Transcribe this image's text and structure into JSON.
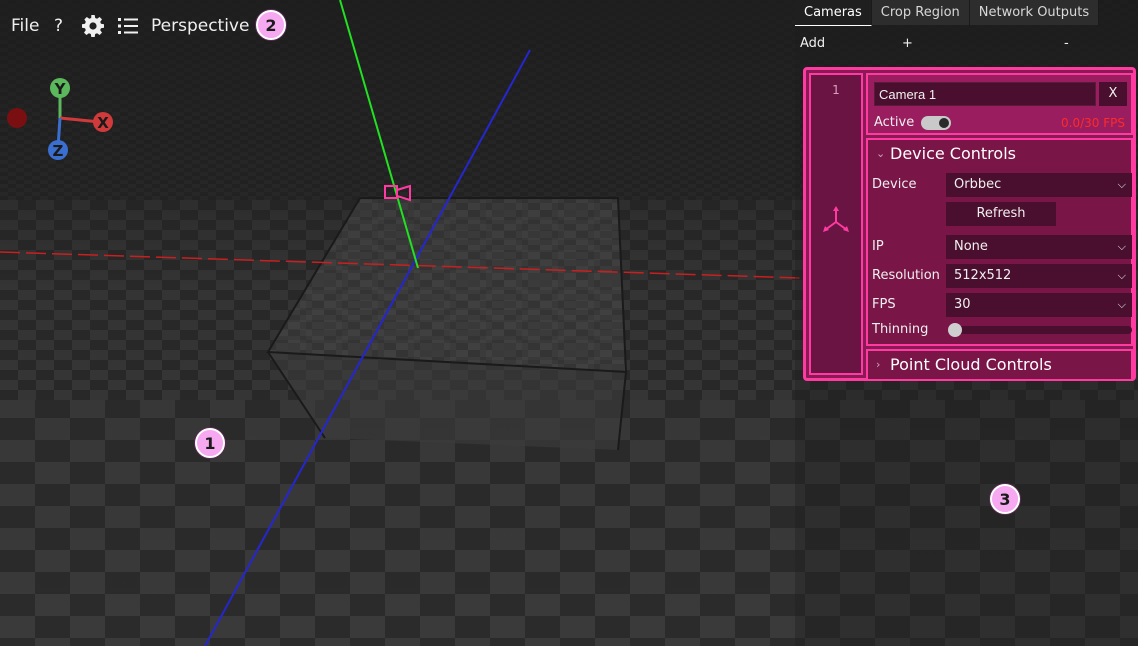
{
  "toolbar": {
    "file_label": "File",
    "help_label": "?",
    "view_mode": "Perspective"
  },
  "gizmo": {
    "y_label": "Y",
    "x_label": "X",
    "z_label": "Z",
    "colors": {
      "x": "#d13a3a",
      "y": "#5cb85c",
      "z": "#3a6fd1",
      "neg_x": "#7a0f12"
    }
  },
  "callouts": {
    "one": "1",
    "two": "2",
    "three": "3"
  },
  "panel": {
    "tabs": [
      {
        "label": "Cameras",
        "active": true
      },
      {
        "label": "Crop Region",
        "active": false
      },
      {
        "label": "Network Outputs",
        "active": false
      }
    ],
    "add_label": "Add",
    "plus_label": "+",
    "minus_label": "-",
    "camera": {
      "index": "1",
      "name": "Camera 1",
      "close_label": "X",
      "active_label": "Active",
      "active": true,
      "fps_status": "0.0/30 FPS",
      "device_controls": {
        "title": "Device Controls",
        "device_label": "Device",
        "device_value": "Orbbec",
        "refresh_label": "Refresh",
        "ip_label": "IP",
        "ip_value": "None",
        "resolution_label": "Resolution",
        "resolution_value": "512x512",
        "fps_label": "FPS",
        "fps_value": "30",
        "thinning_label": "Thinning",
        "thinning_value": 0
      },
      "point_cloud_controls": {
        "title": "Point Cloud Controls"
      }
    }
  },
  "colors": {
    "accent": "#ff3aa0",
    "card_bg": "#8a1a55",
    "fps_error": "#ff2a2a"
  }
}
